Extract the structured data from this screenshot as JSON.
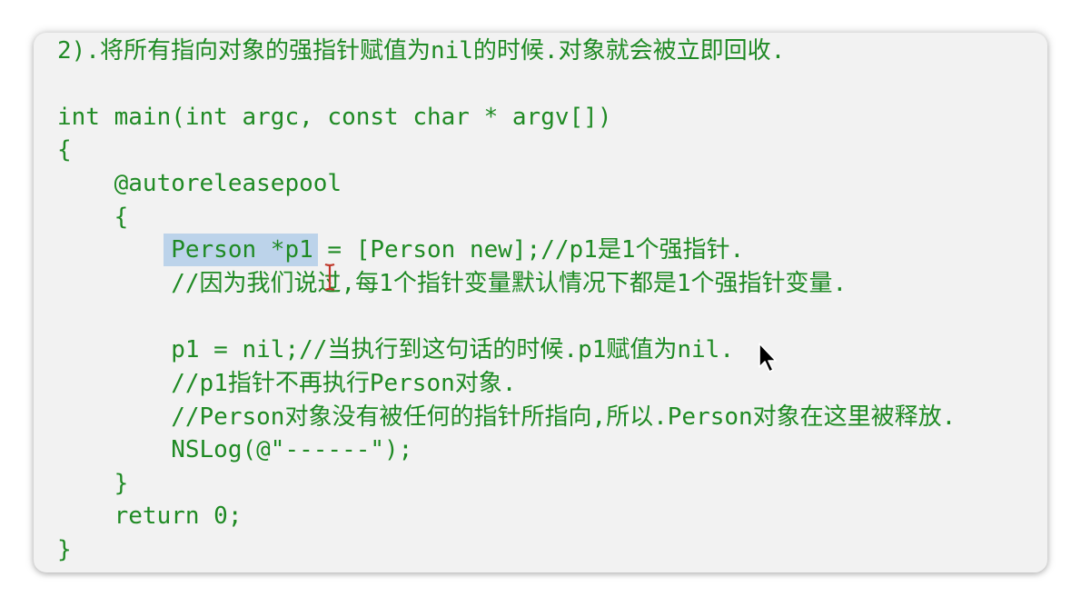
{
  "code": {
    "lines": [
      "2).将所有指向对象的强指针赋值为nil的时候.对象就会被立即回收.",
      "",
      "int main(int argc, const char * argv[])",
      "{",
      "    @autoreleasepool",
      "    {",
      "        Person *p1 = [Person new];//p1是1个强指针.",
      "        //因为我们说过,每1个指针变量默认情况下都是1个强指针变量.",
      "",
      "        p1 = nil;//当执行到这句话的时候.p1赋值为nil.",
      "        //p1指针不再执行Person对象.",
      "        //Person对象没有被任何的指针所指向,所以.Person对象在这里被释放.",
      "        NSLog(@\"------\");",
      "    }",
      "    return 0;",
      "}"
    ],
    "selected_text": "Person *p1",
    "text_color": "#1f8a24",
    "selection_color": "#bcd3ea",
    "background_color": "#f2f2f2"
  },
  "cursors": {
    "text_cursor_icon": "ibeam-cursor-icon",
    "pointer_icon": "arrow-pointer-icon"
  }
}
